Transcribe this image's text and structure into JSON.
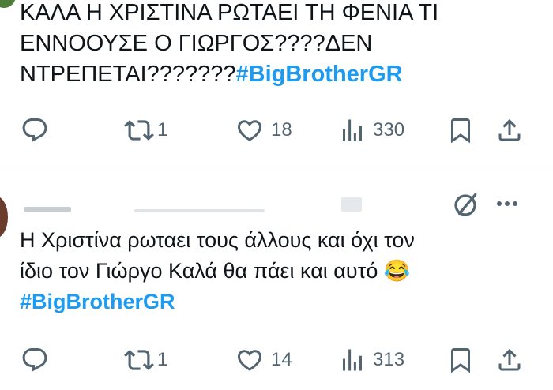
{
  "tweet1": {
    "text_line1": "ΚΑΛΑ Η ΧΡΙΣΤΙΝΑ ΡΩΤΑΕΙ ΤΗ ΦΕΝΙΑ ΤΙ",
    "text_line2": "ΕΝΝΟΟΥΣΕ Ο ΓΙΩΡΓΟΣ????ΔΕΝ",
    "text_line3": "ΝΤΡΕΠΕΤΑΙ???????",
    "hashtag": "#BigBrotherGR",
    "replies": "",
    "retweets": "1",
    "likes": "18",
    "views": "330"
  },
  "tweet2": {
    "text_line1": "Η Χριστίνα ρωταει τους άλλους και όχι τον",
    "text_line2": "ίδιο τον Γιώργο Καλά θα πάει και αυτό",
    "emoji": "😂",
    "hashtag": "#BigBrotherGR",
    "replies": "",
    "retweets": "1",
    "likes": "14",
    "views": "313"
  },
  "icons": {
    "reply": "reply-icon",
    "retweet": "retweet-icon",
    "like": "heart-icon",
    "views": "views-icon",
    "bookmark": "bookmark-icon",
    "share": "share-icon",
    "grok": "grok-icon",
    "more": "more-icon"
  },
  "colors": {
    "hashtag": "#1d9bf0",
    "icon": "#536471",
    "text": "#0f1419"
  }
}
